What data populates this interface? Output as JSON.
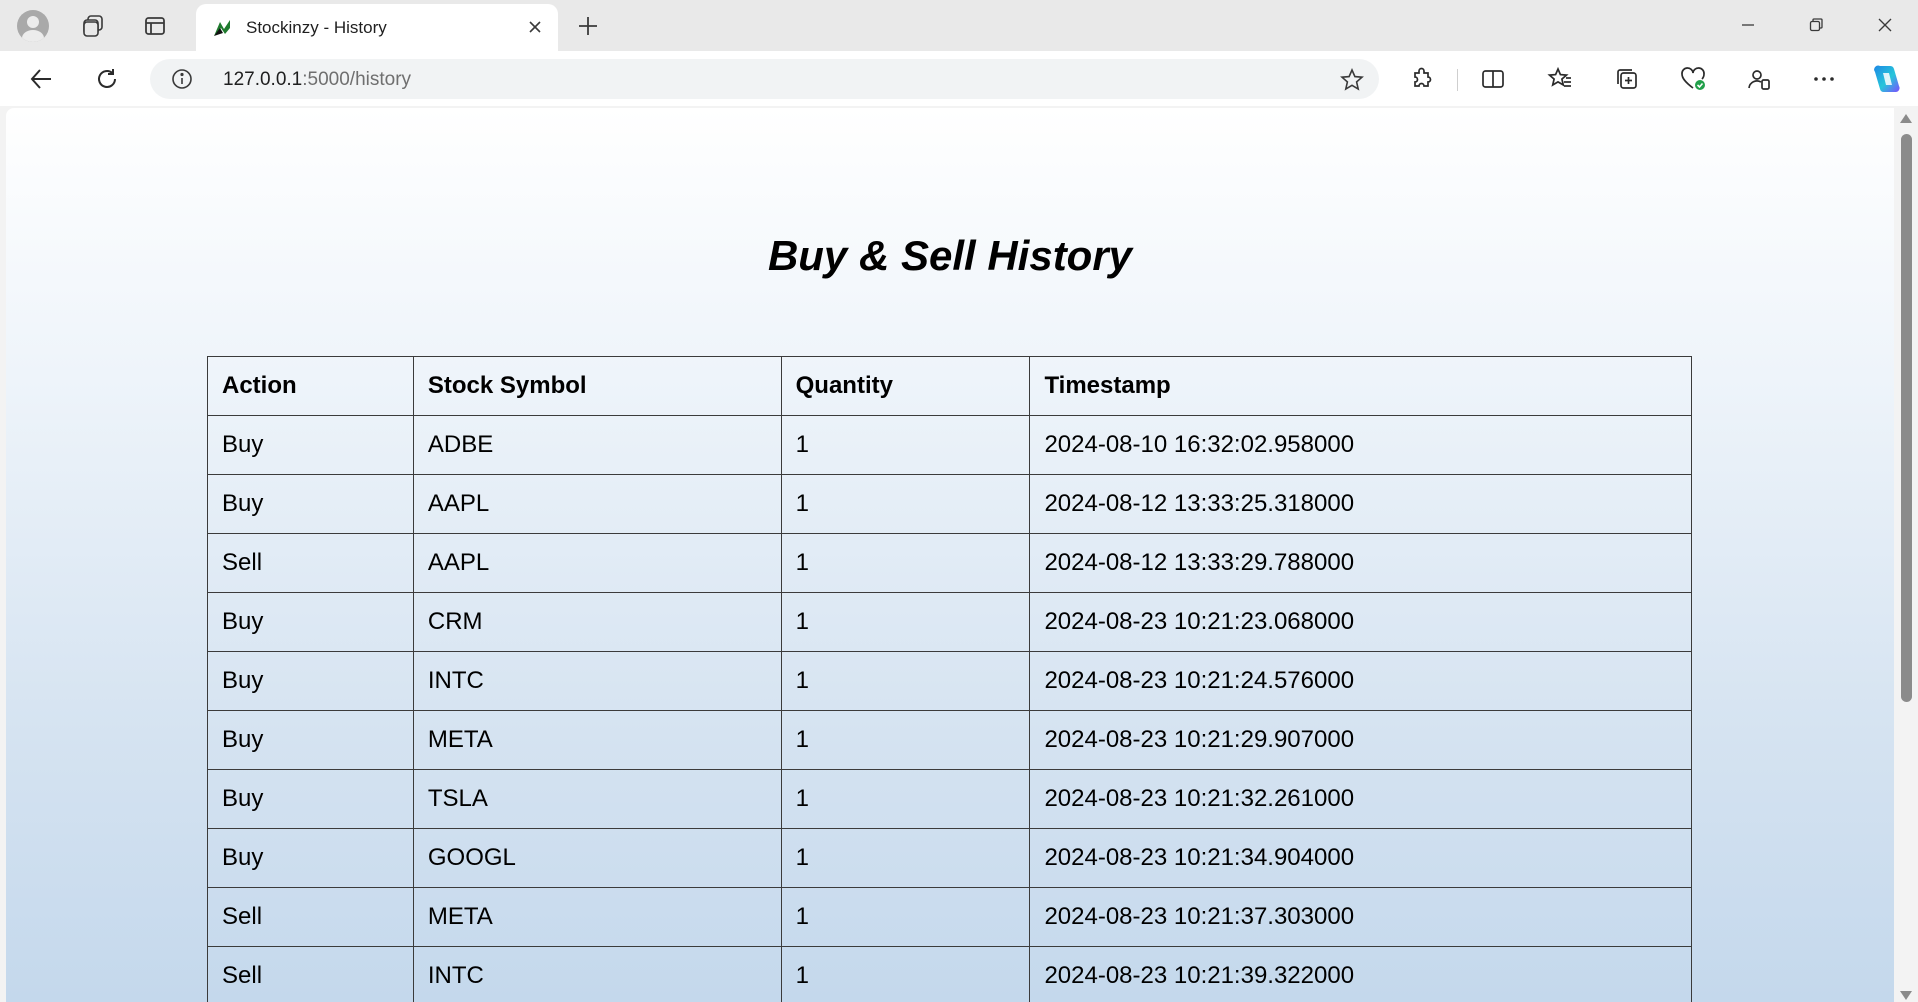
{
  "browser": {
    "tab": {
      "title": "Stockinzy - History"
    },
    "address_bar": {
      "host": "127.0.0.1",
      "path": ":5000/history"
    },
    "colors": {
      "favicon_green": "#1f7a2e",
      "copilot_blue": "#1e88e5"
    }
  },
  "page": {
    "title": "Buy & Sell History",
    "table": {
      "headers": [
        "Action",
        "Stock Symbol",
        "Quantity",
        "Timestamp"
      ],
      "rows": [
        [
          "Buy",
          "ADBE",
          "1",
          "2024-08-10 16:32:02.958000"
        ],
        [
          "Buy",
          "AAPL",
          "1",
          "2024-08-12 13:33:25.318000"
        ],
        [
          "Sell",
          "AAPL",
          "1",
          "2024-08-12 13:33:29.788000"
        ],
        [
          "Buy",
          "CRM",
          "1",
          "2024-08-23 10:21:23.068000"
        ],
        [
          "Buy",
          "INTC",
          "1",
          "2024-08-23 10:21:24.576000"
        ],
        [
          "Buy",
          "META",
          "1",
          "2024-08-23 10:21:29.907000"
        ],
        [
          "Buy",
          "TSLA",
          "1",
          "2024-08-23 10:21:32.261000"
        ],
        [
          "Buy",
          "GOOGL",
          "1",
          "2024-08-23 10:21:34.904000"
        ],
        [
          "Sell",
          "META",
          "1",
          "2024-08-23 10:21:37.303000"
        ],
        [
          "Sell",
          "INTC",
          "1",
          "2024-08-23 10:21:39.322000"
        ]
      ]
    }
  }
}
